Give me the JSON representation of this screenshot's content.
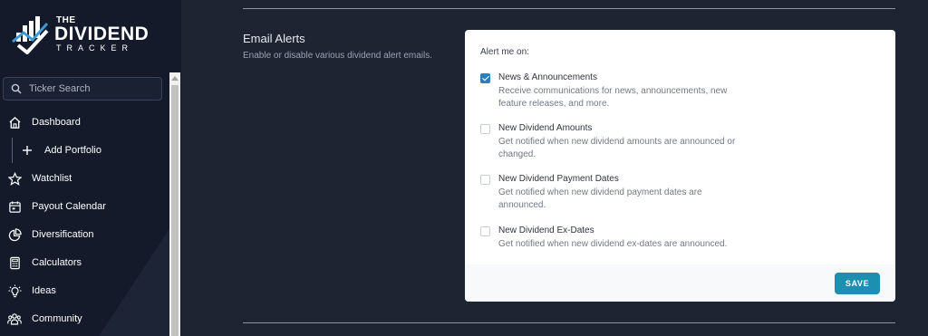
{
  "brand": {
    "line1": "THE",
    "line2": "DIVIDEND",
    "line3": "TRACKER"
  },
  "search": {
    "placeholder": "Ticker Search"
  },
  "nav": [
    {
      "label": "Dashboard",
      "icon": "home-icon"
    },
    {
      "label": "Add Portfolio",
      "icon": "plus-icon"
    },
    {
      "label": "Watchlist",
      "icon": "star-icon"
    },
    {
      "label": "Payout Calendar",
      "icon": "calendar-icon"
    },
    {
      "label": "Diversification",
      "icon": "pie-chart-icon"
    },
    {
      "label": "Calculators",
      "icon": "calculator-icon"
    },
    {
      "label": "Ideas",
      "icon": "lightbulb-icon"
    },
    {
      "label": "Community",
      "icon": "users-icon"
    }
  ],
  "section": {
    "title": "Email Alerts",
    "description": "Enable or disable various dividend alert emails."
  },
  "alerts": {
    "label": "Alert me on:",
    "options": [
      {
        "title": "News & Announcements",
        "description": "Receive communications for news, announcements, new feature releases, and more.",
        "checked": true
      },
      {
        "title": "New Dividend Amounts",
        "description": "Get notified when new dividend amounts are announced or changed.",
        "checked": false
      },
      {
        "title": "New Dividend Payment Dates",
        "description": "Get notified when new dividend payment dates are announced.",
        "checked": false
      },
      {
        "title": "New Dividend Ex-Dates",
        "description": "Get notified when new dividend ex-dates are announced.",
        "checked": false
      }
    ],
    "save_label": "SAVE"
  },
  "colors": {
    "background": "#1f2433",
    "sidebar": "#141a2a",
    "accent": "#1e8fb0",
    "checkbox": "#2a7fc0"
  }
}
